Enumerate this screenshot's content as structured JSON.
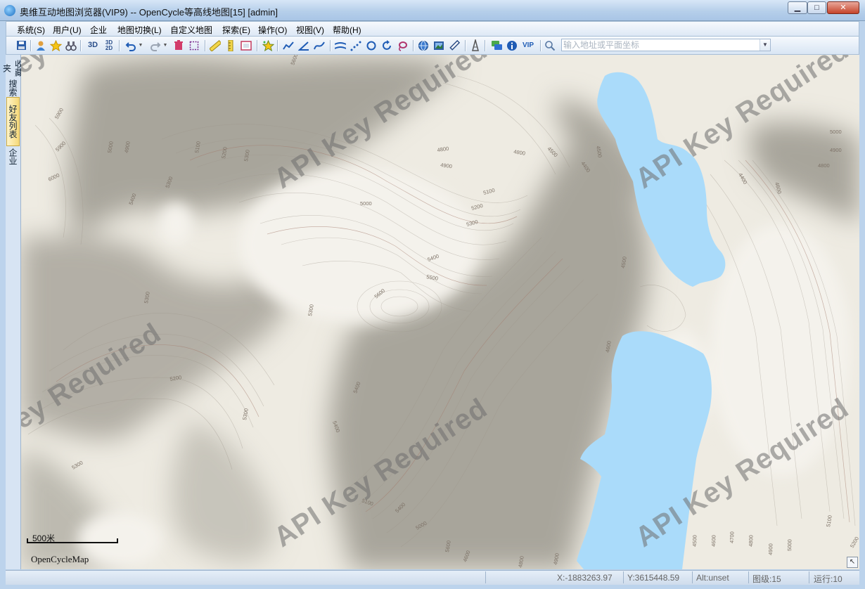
{
  "window": {
    "title": "奥维互动地图浏览器(VIP9) -- OpenCycle等高线地图[15] [admin]",
    "buttons": {
      "minimize": "▁",
      "maximize": "□",
      "close": "✕"
    }
  },
  "menu": {
    "items": [
      {
        "label": "系统(S)"
      },
      {
        "label": "用户(U)"
      },
      {
        "label": "企业"
      },
      {
        "label": "地图切换(L)"
      },
      {
        "label": "自定义地图"
      },
      {
        "label": "探索(E)"
      },
      {
        "label": "操作(O)"
      },
      {
        "label": "视图(V)"
      },
      {
        "label": "帮助(H)"
      }
    ]
  },
  "toolbar": {
    "label_3d": "3D",
    "label_3d2d_top": "3D",
    "label_2d": "2D",
    "label_vip": "VIP",
    "search_placeholder": "输入地址或平面坐标",
    "icons": [
      "save-icon",
      "user-icon",
      "favorite-star-icon",
      "binoculars-icon",
      "3d-view-icon",
      "3d-2d-toggle-icon",
      "undo-icon",
      "undo-dropdown-icon",
      "redo-icon",
      "redo-dropdown-icon",
      "delete-icon",
      "select-rect-icon",
      "ruler-icon",
      "vertical-ruler-icon",
      "frame-icon",
      "highlight-star-icon",
      "draw-line-icon",
      "angle-icon",
      "curve-icon",
      "road-icon",
      "dotted-path-icon",
      "circle-icon",
      "rotate-icon",
      "lasso-icon",
      "globe-icon",
      "layer-image-icon",
      "pen-icon",
      "tower-icon",
      "message-icon",
      "info-icon",
      "vip-icon",
      "search-icon"
    ]
  },
  "sidebar": {
    "tabs": [
      {
        "label": "收藏夹"
      },
      {
        "label": "搜索"
      },
      {
        "label": "好友列表"
      },
      {
        "label": "企业"
      }
    ]
  },
  "map": {
    "watermark": "API Key Required",
    "scale_label": "500米",
    "attribution": "OpenCycleMap",
    "water_color": "#aadbfa",
    "contour_labels": [
      "5600",
      "5900",
      "6000",
      "5000",
      "4900",
      "5000",
      "4800",
      "4900",
      "5100",
      "5200",
      "5300",
      "5400",
      "5500",
      "5600",
      "5300",
      "5300",
      "5200",
      "5300",
      "5400",
      "4900",
      "4800",
      "4500",
      "4400",
      "4500",
      "4600",
      "4900",
      "4800",
      "5000",
      "4800",
      "4600",
      "4500",
      "4400",
      "4700",
      "4800",
      "4900",
      "5000",
      "5100",
      "5200",
      "5300",
      "5400",
      "5100",
      "5000",
      "5600",
      "5300"
    ],
    "corner_button": "↖"
  },
  "status": {
    "x": "X:-1883263.97",
    "y": "Y:3615448.59",
    "alt": "Alt:unset",
    "zoom": "图级:15",
    "running": "运行:10"
  }
}
